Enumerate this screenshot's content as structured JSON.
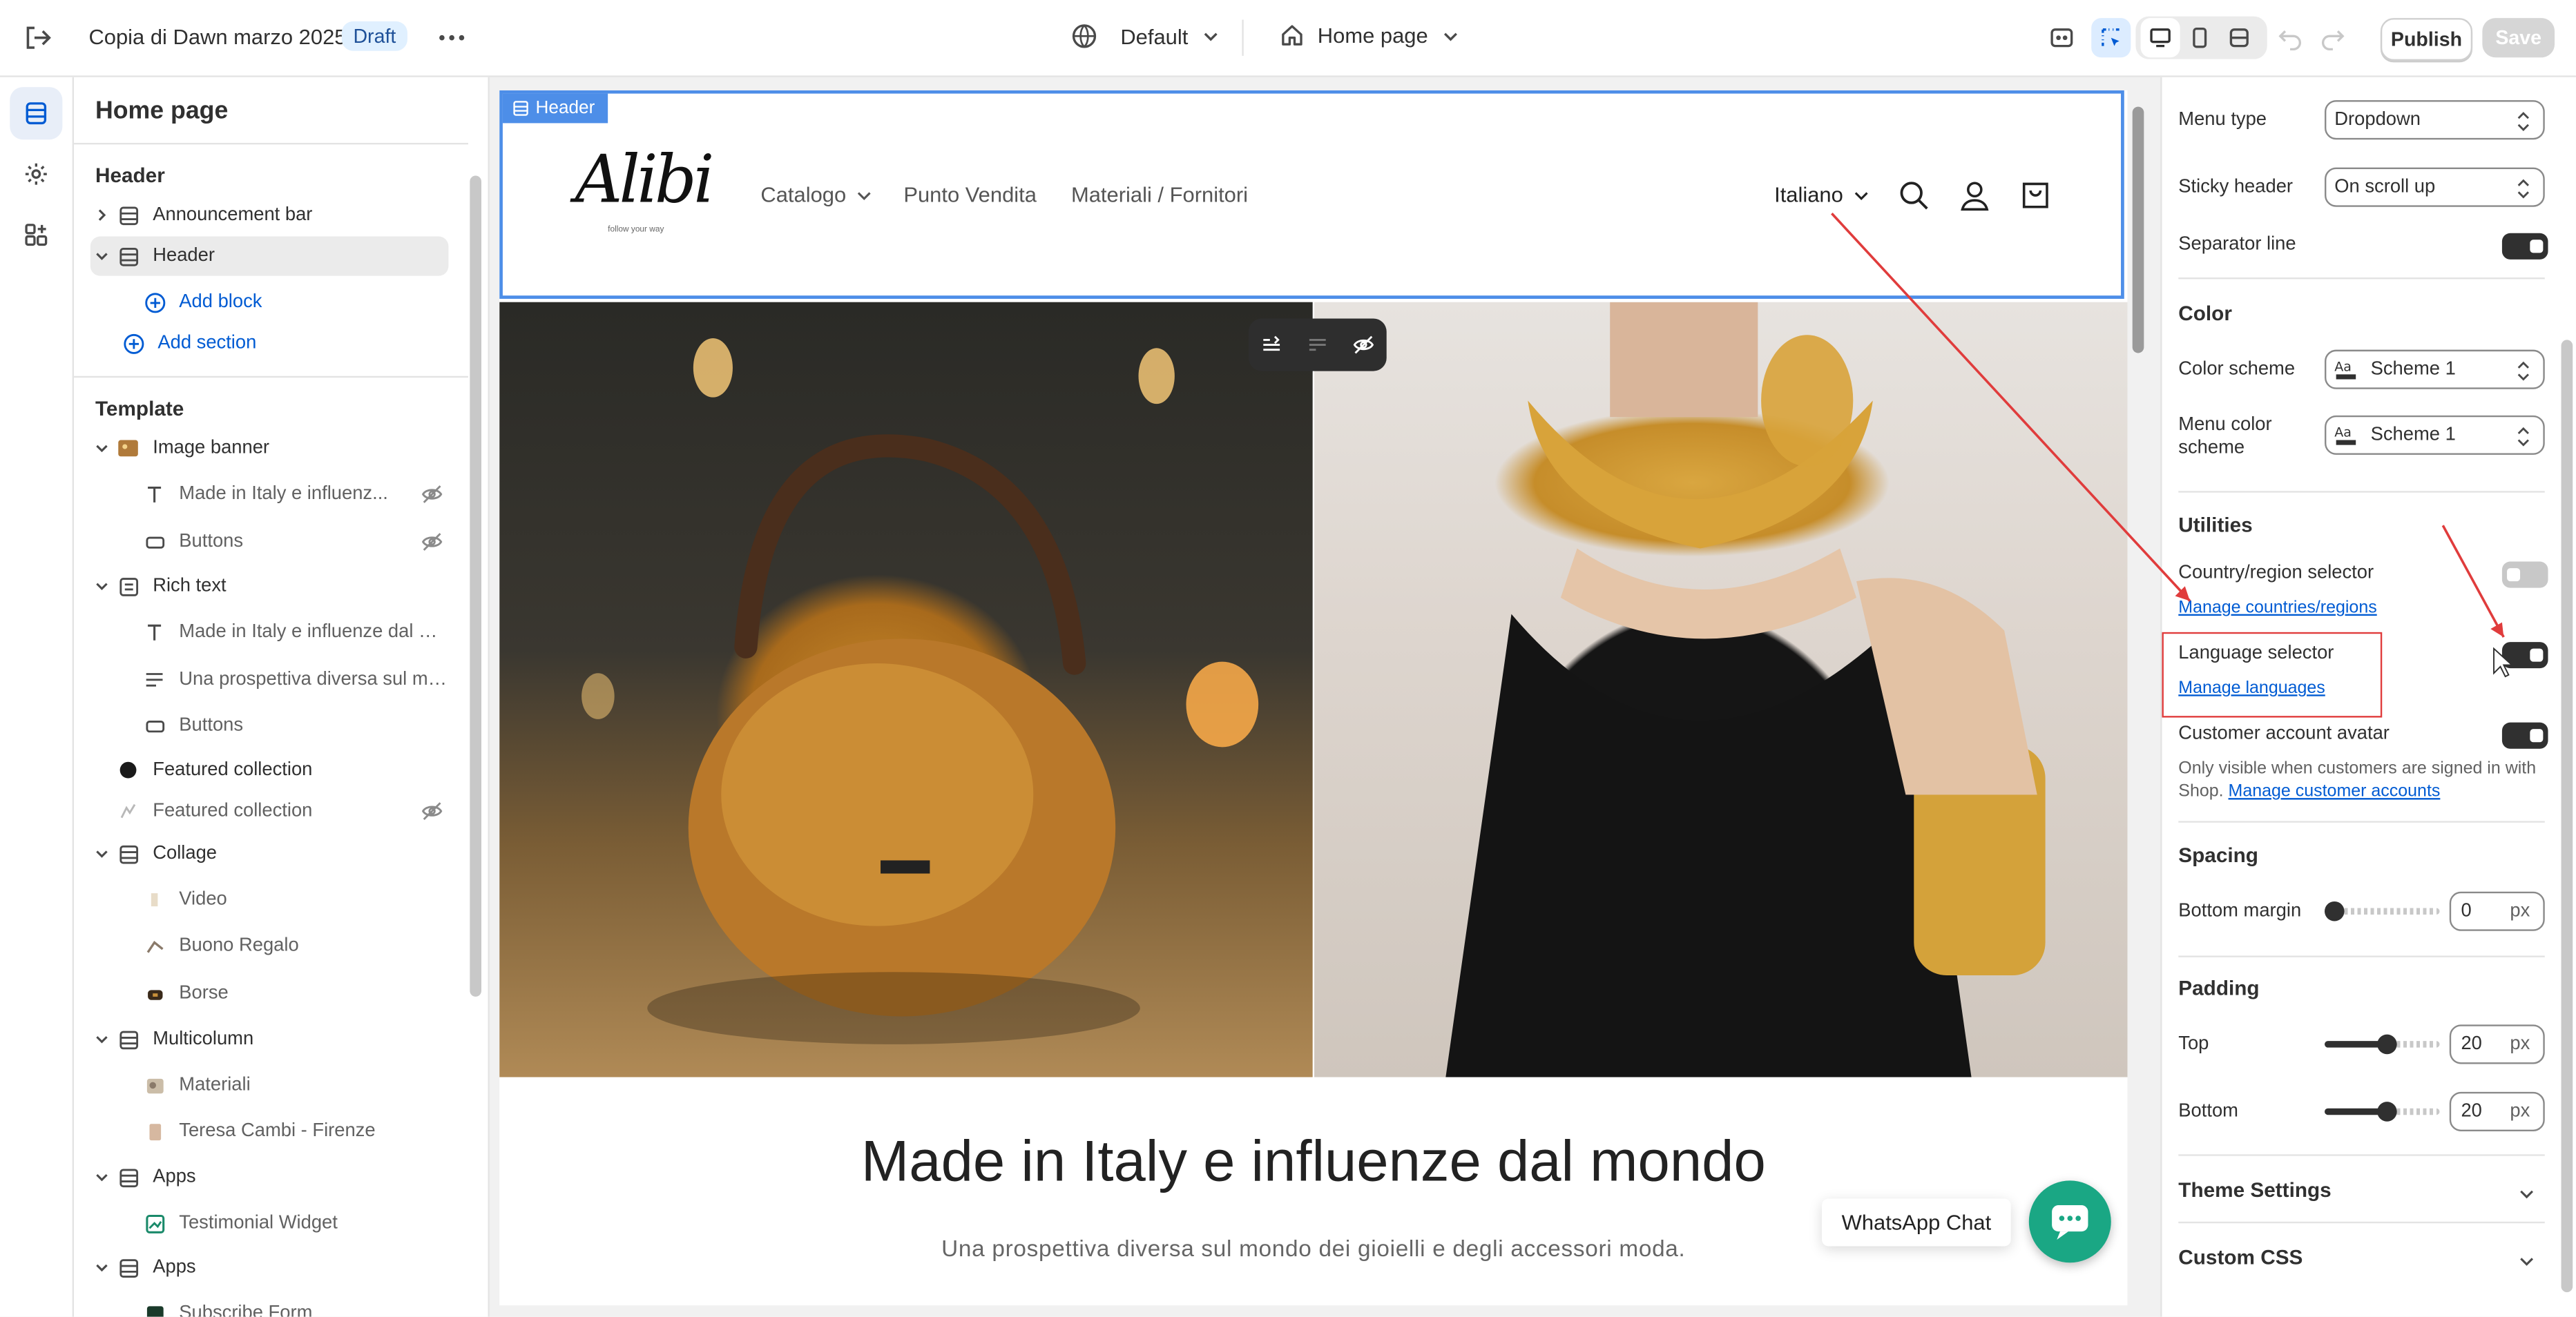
{
  "topbar": {
    "store_title": "Copia di Dawn marzo 2025",
    "status_badge": "Draft",
    "theme_dropdown": "Default",
    "page_dropdown": "Home page",
    "publish_label": "Publish",
    "save_label": "Save"
  },
  "left_panel": {
    "title": "Home page",
    "header_section": {
      "heading": "Header",
      "items": [
        {
          "label": "Announcement bar"
        },
        {
          "label": "Header"
        }
      ],
      "add_block": "Add block",
      "add_section": "Add section"
    },
    "template": {
      "heading": "Template",
      "items": [
        {
          "label": "Image banner"
        },
        {
          "label": "Made in Italy e influenz..."
        },
        {
          "label": "Buttons"
        },
        {
          "label": "Rich text"
        },
        {
          "label": "Made in Italy e influenze dal mo..."
        },
        {
          "label": "Una prospettiva diversa sul mon..."
        },
        {
          "label": "Buttons"
        },
        {
          "label": "Featured collection"
        },
        {
          "label": "Featured collection"
        },
        {
          "label": "Collage"
        },
        {
          "label": "Video"
        },
        {
          "label": "Buono Regalo"
        },
        {
          "label": "Borse"
        },
        {
          "label": "Multicolumn"
        },
        {
          "label": "Materiali"
        },
        {
          "label": "Teresa Cambi - Firenze"
        },
        {
          "label": "Apps"
        },
        {
          "label": "Testimonial Widget"
        },
        {
          "label": "Apps"
        },
        {
          "label": "Subscribe Form"
        }
      ]
    }
  },
  "preview": {
    "header_tag": "Header",
    "logo_text": "Alibi",
    "logo_tagline": "follow your way",
    "nav": [
      "Catalogo",
      "Punto Vendita",
      "Materiali / Fornitori"
    ],
    "language": "Italiano",
    "headline": "Made in Italy e influenze dal mondo",
    "subheadline": "Una prospettiva diversa sul mondo dei gioielli e degli accessori moda.",
    "whatsapp_label": "WhatsApp Chat"
  },
  "right_panel": {
    "menu_type_label": "Menu type",
    "menu_type_value": "Dropdown",
    "sticky_label": "Sticky header",
    "sticky_value": "On scroll up",
    "separator_label": "Separator line",
    "separator_on": true,
    "color_heading": "Color",
    "color_scheme_label": "Color scheme",
    "color_scheme_value": "Scheme 1",
    "menu_color_label": "Menu color scheme",
    "menu_color_value": "Scheme 1",
    "utilities_heading": "Utilities",
    "country_label": "Country/region selector",
    "country_on": false,
    "country_link": "Manage countries/regions",
    "language_label": "Language selector",
    "language_on": true,
    "language_link": "Manage languages",
    "avatar_label": "Customer account avatar",
    "avatar_on": true,
    "avatar_hint": "Only visible when customers are signed in with Shop.",
    "avatar_link": "Manage customer accounts",
    "spacing_heading": "Spacing",
    "bottom_margin_label": "Bottom margin",
    "bottom_margin_value": "0",
    "padding_heading": "Padding",
    "top_label": "Top",
    "top_value": "20",
    "bottom_label": "Bottom",
    "bottom_value": "20",
    "unit": "px",
    "theme_settings": "Theme Settings",
    "custom_css": "Custom CSS"
  },
  "colors": {
    "accent_blue": "#005bd3",
    "selection_blue": "#4d8ee8",
    "annotation_red": "#e03c3c",
    "whatsapp_green": "#1aa784"
  }
}
